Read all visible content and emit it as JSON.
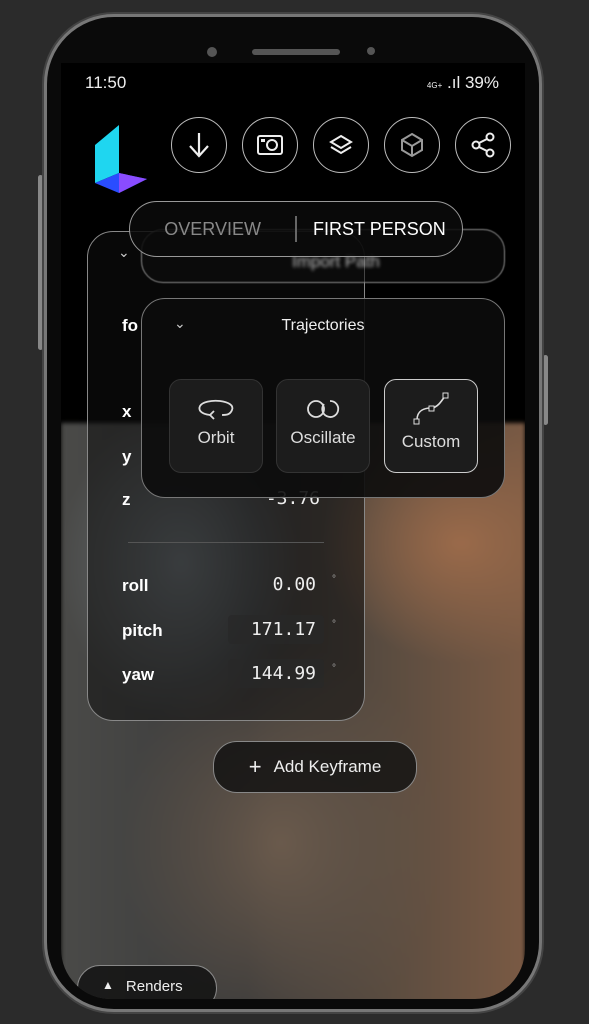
{
  "status": {
    "time": "11:50",
    "network": "4G+",
    "battery": "39%"
  },
  "toolbar": {
    "icons": [
      "download-icon",
      "camera-icon",
      "layers-icon",
      "cube-icon",
      "share-icon"
    ]
  },
  "tabs": {
    "items": [
      "OVERVIEW",
      "FIRST PERSON"
    ],
    "active": "FIRST PERSON"
  },
  "import_path": {
    "label": "Import Path"
  },
  "camera_panel": {
    "fov_label": "fo",
    "x_label": "x",
    "y_label": "y",
    "z_label": "z",
    "z_value": "-3.76",
    "roll_label": "roll",
    "roll": "0.00",
    "pitch_label": "pitch",
    "pitch": "171.17",
    "yaw_label": "yaw",
    "yaw": "144.99",
    "degree": "°"
  },
  "trajectories": {
    "title": "Trajectories",
    "options": [
      "Orbit",
      "Oscillate",
      "Custom"
    ],
    "selected": "Custom"
  },
  "add_keyframe": {
    "icon": "plus-icon",
    "label": "Add Keyframe"
  },
  "renders": {
    "icon": "chevron-up-icon",
    "label": "Renders"
  },
  "colors": {
    "logo_cyan": "#1fd6f0",
    "logo_blue": "#2a4dff",
    "logo_purple": "#8a4cff"
  }
}
